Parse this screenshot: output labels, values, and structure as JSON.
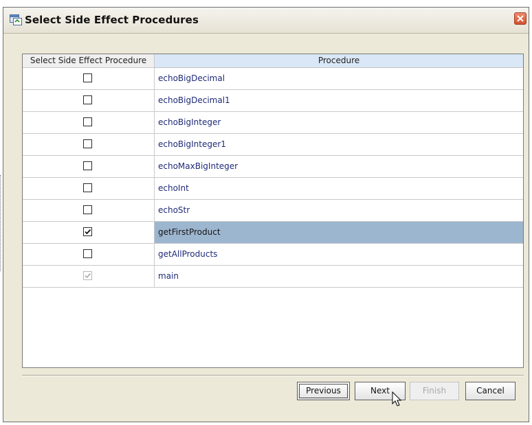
{
  "window": {
    "title": "Select Side Effect Procedures",
    "icon": "procedure-window-icon",
    "close_icon": "close-icon"
  },
  "table": {
    "headers": [
      "Select Side Effect Procedure",
      "Procedure"
    ],
    "rows": [
      {
        "procedure": "echoBigDecimal",
        "checked": false,
        "enabled": true,
        "selected": false
      },
      {
        "procedure": "echoBigDecimal1",
        "checked": false,
        "enabled": true,
        "selected": false
      },
      {
        "procedure": "echoBigInteger",
        "checked": false,
        "enabled": true,
        "selected": false
      },
      {
        "procedure": "echoBigInteger1",
        "checked": false,
        "enabled": true,
        "selected": false
      },
      {
        "procedure": "echoMaxBigInteger",
        "checked": false,
        "enabled": true,
        "selected": false
      },
      {
        "procedure": "echoInt",
        "checked": false,
        "enabled": true,
        "selected": false
      },
      {
        "procedure": "echoStr",
        "checked": false,
        "enabled": true,
        "selected": false
      },
      {
        "procedure": "getFirstProduct",
        "checked": true,
        "enabled": true,
        "selected": true
      },
      {
        "procedure": "getAllProducts",
        "checked": false,
        "enabled": true,
        "selected": false
      },
      {
        "procedure": "main",
        "checked": true,
        "enabled": false,
        "selected": false
      }
    ]
  },
  "buttons": {
    "previous": "Previous",
    "next": "Next",
    "finish": "Finish",
    "cancel": "Cancel"
  },
  "colors": {
    "selected_row": "#9db6cf",
    "header_highlight": "#d9e7f6",
    "procedure_text": "#1e2a78"
  }
}
